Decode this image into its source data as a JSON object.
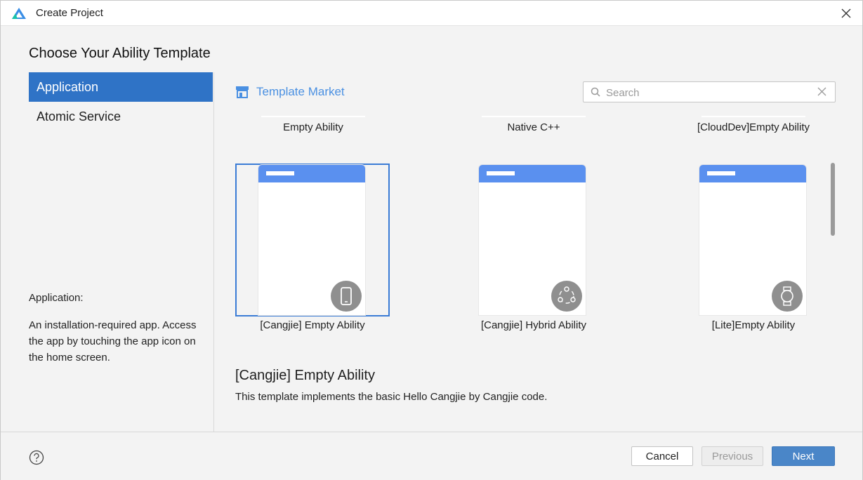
{
  "window": {
    "title": "Create Project"
  },
  "heading": "Choose Your Ability Template",
  "sidebar": {
    "items": [
      {
        "label": "Application",
        "active": true
      },
      {
        "label": "Atomic Service",
        "active": false
      }
    ],
    "desc_title": "Application:",
    "desc": "An installation-required app. Access the app by touching the app icon on the home screen."
  },
  "market": {
    "label": "Template Market",
    "icon": "store-icon"
  },
  "search": {
    "placeholder": "Search",
    "value": ""
  },
  "templates_top": [
    "Empty Ability",
    "Native C++",
    "[CloudDev]Empty Ability"
  ],
  "templates": [
    {
      "label": "[Cangjie] Empty Ability",
      "icon": "phone-icon",
      "selected": true
    },
    {
      "label": "[Cangjie] Hybrid Ability",
      "icon": "hybrid-icon",
      "selected": false
    },
    {
      "label": "[Lite]Empty Ability",
      "icon": "watch-icon",
      "selected": false
    }
  ],
  "detail": {
    "title": "[Cangjie] Empty Ability",
    "desc": "This template implements the basic Hello Cangjie by Cangjie code."
  },
  "footer": {
    "cancel": "Cancel",
    "previous": "Previous",
    "next": "Next",
    "help_icon": "help-icon"
  },
  "colors": {
    "accent": "#2f73c6",
    "market": "#4a90e2",
    "card_header": "#5a90ef",
    "primary_button": "#4a86c8"
  }
}
